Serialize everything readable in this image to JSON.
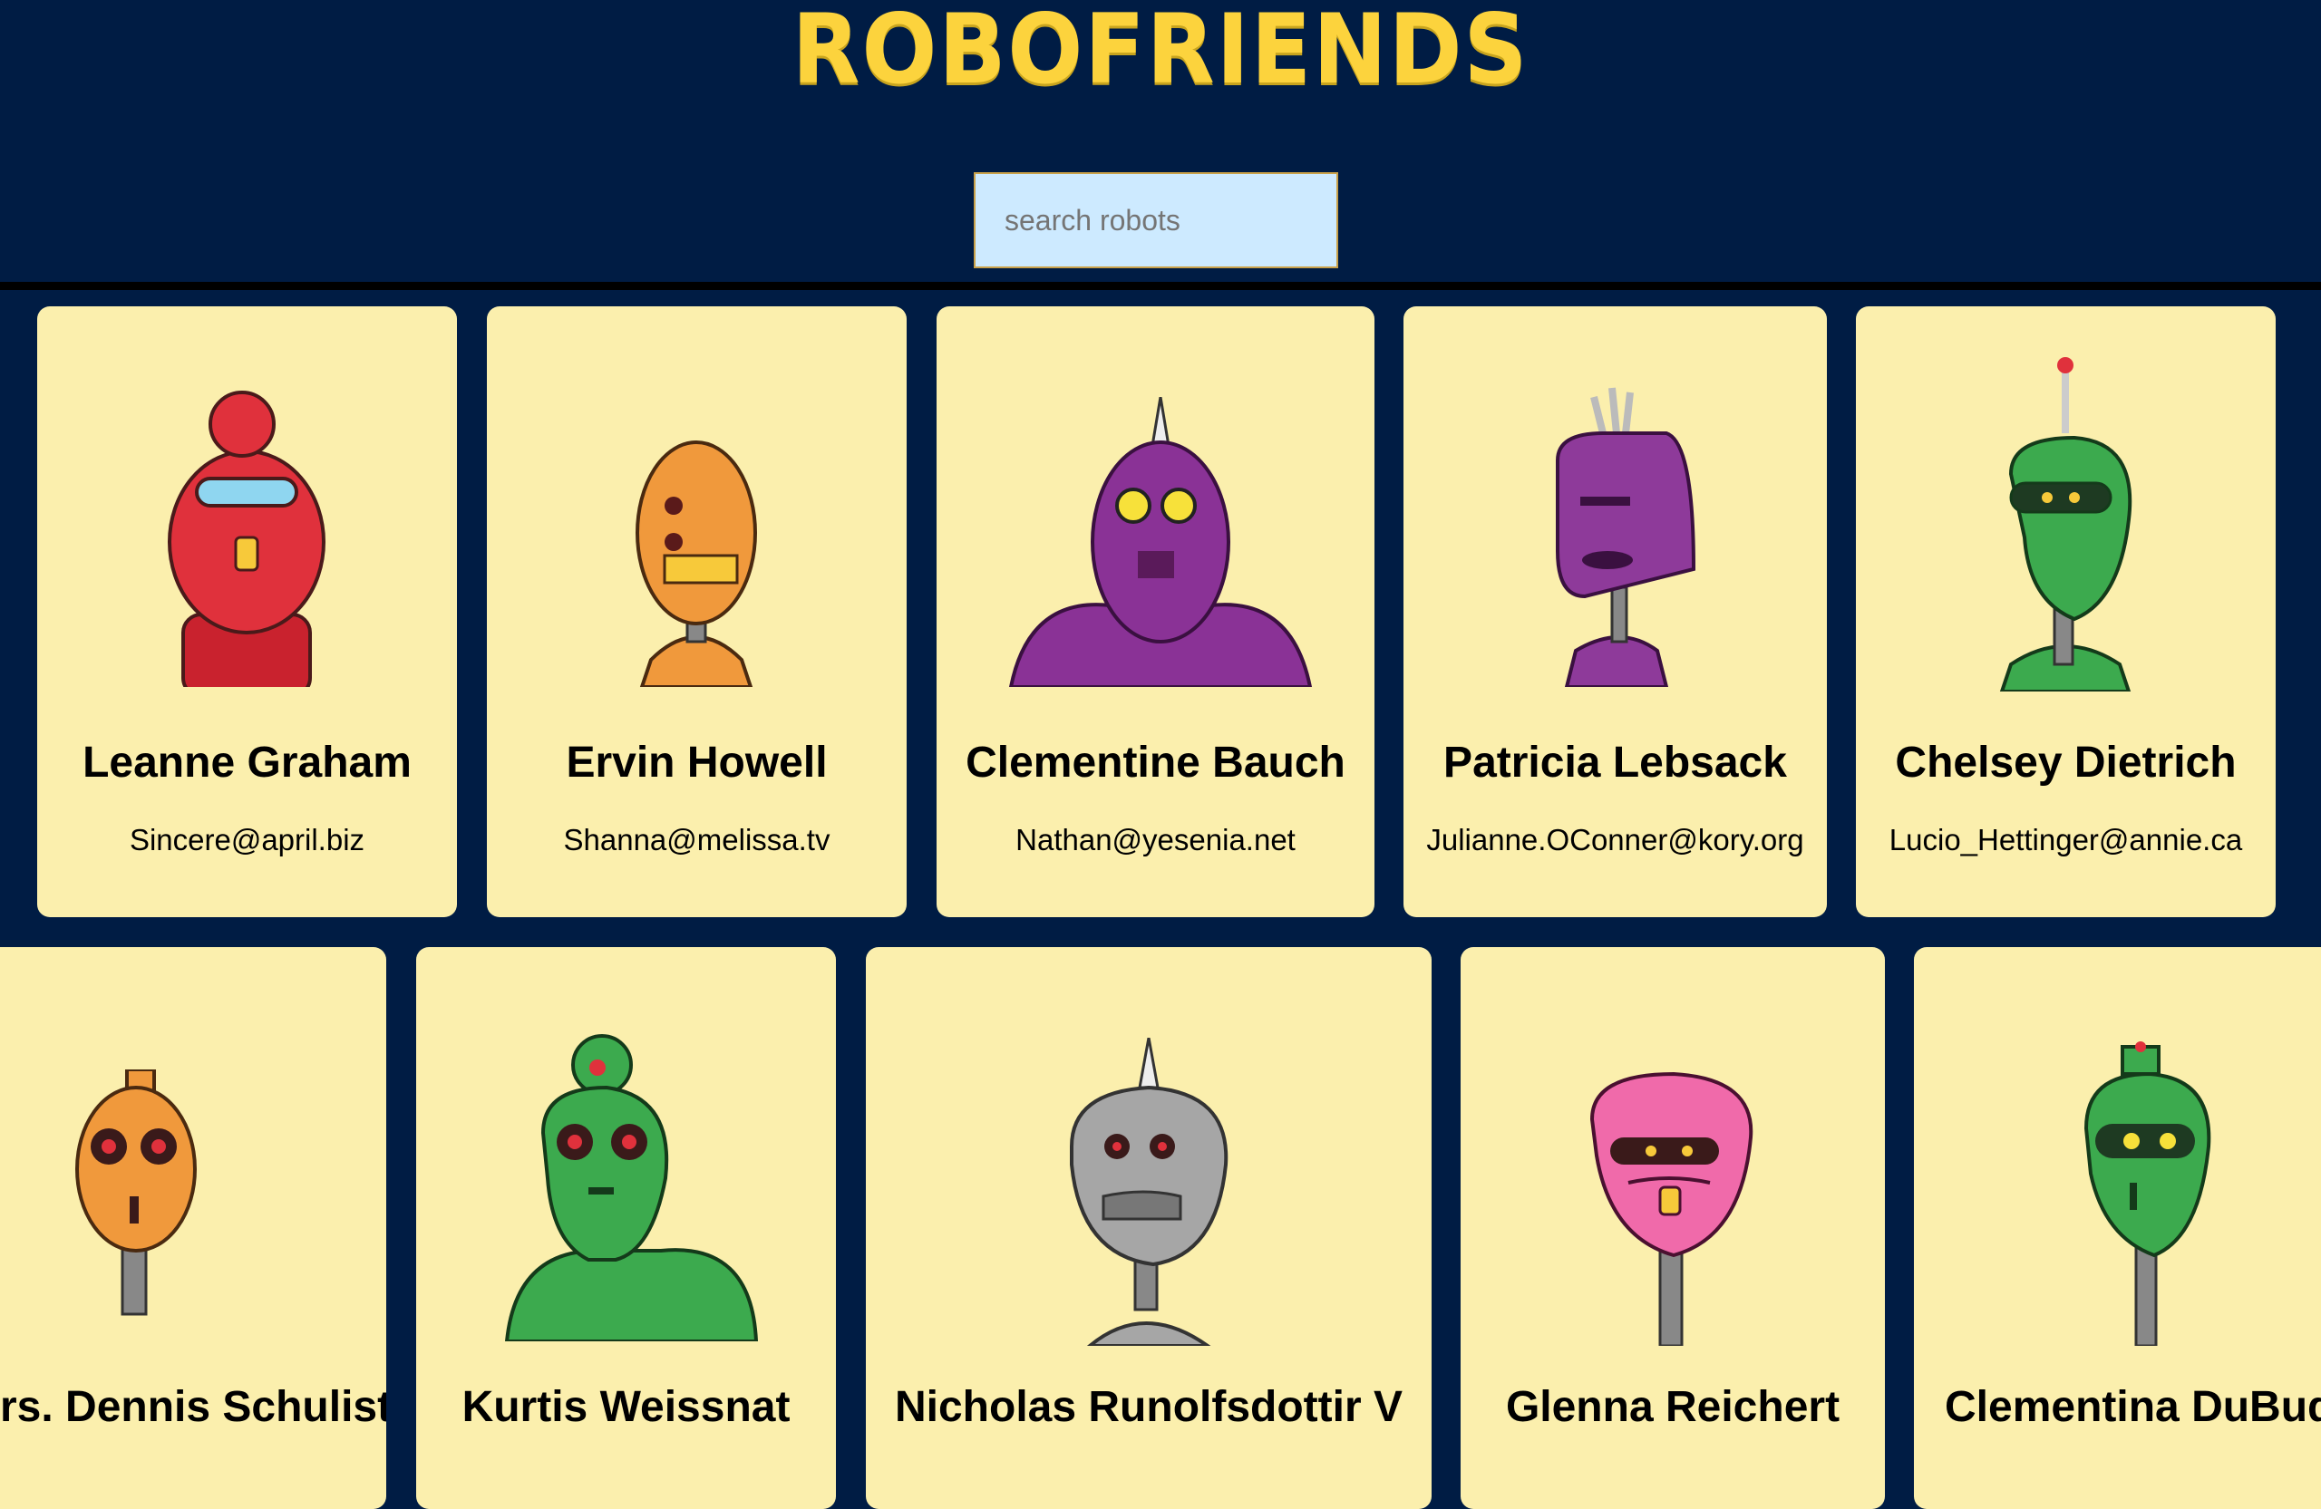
{
  "app": {
    "title": "ROBOFRIENDS"
  },
  "search": {
    "placeholder": "search robots",
    "value": ""
  },
  "robots": [
    {
      "name": "Leanne Graham",
      "email": "Sincere@april.biz",
      "color": "#e0313c"
    },
    {
      "name": "Ervin Howell",
      "email": "Shanna@melissa.tv",
      "color": "#f0993c"
    },
    {
      "name": "Clementine Bauch",
      "email": "Nathan@yesenia.net",
      "color": "#8a3296"
    },
    {
      "name": "Patricia Lebsack",
      "email": "Julianne.OConner@kory.org",
      "color": "#8e3a9a"
    },
    {
      "name": "Chelsey Dietrich",
      "email": "Lucio_Hettinger@annie.ca",
      "color": "#3caa4e"
    },
    {
      "name": "Mrs. Dennis Schulist",
      "email": "",
      "color": "#f0993c"
    },
    {
      "name": "Kurtis Weissnat",
      "email": "",
      "color": "#3caa4e"
    },
    {
      "name": "Nicholas Runolfsdottir V",
      "email": "",
      "color": "#a6a6a6"
    },
    {
      "name": "Glenna Reichert",
      "email": "",
      "color": "#f06aaa"
    },
    {
      "name": "Clementina DuBuque",
      "email": "",
      "color": "#3caa4e"
    }
  ]
}
